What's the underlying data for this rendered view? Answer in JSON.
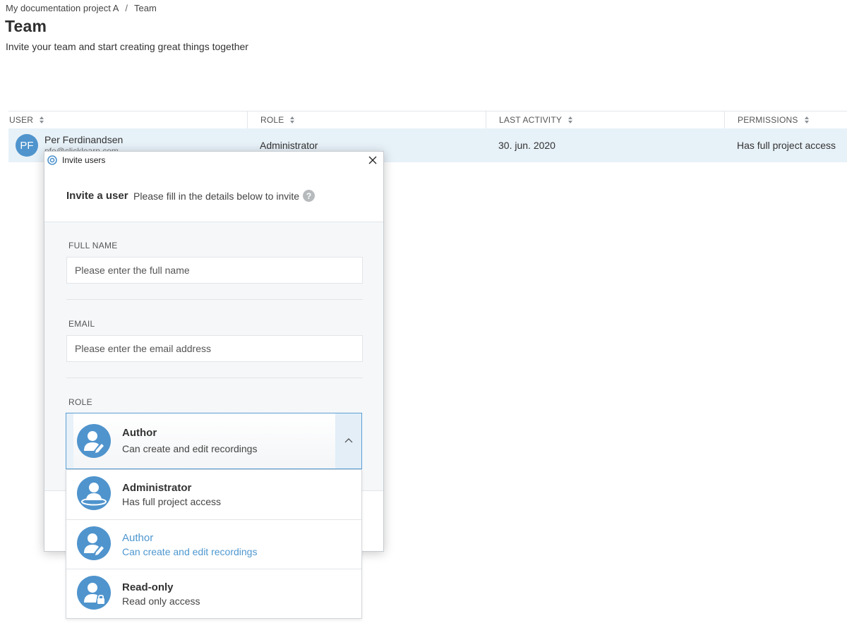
{
  "breadcrumb": {
    "project": "My documentation project A",
    "separator": "/",
    "current": "Team"
  },
  "page": {
    "title": "Team",
    "subtitle": "Invite your team and start creating great things together"
  },
  "table": {
    "columns": {
      "user": "USER",
      "role": "ROLE",
      "last_activity": "LAST ACTIVITY",
      "permissions": "PERMISSIONS"
    },
    "rows": [
      {
        "initials": "PF",
        "name": "Per Ferdinandsen",
        "email": "pfe@clicklearn.com",
        "role": "Administrator",
        "last_activity": "30. jun. 2020",
        "permissions": "Has full project access"
      }
    ]
  },
  "modal": {
    "window_title": "Invite users",
    "heading": "Invite a user",
    "heading_hint": "Please fill in the details below to invite",
    "help_glyph": "?",
    "full_name": {
      "label": "FULL NAME",
      "placeholder": "Please enter the full name",
      "value": ""
    },
    "email": {
      "label": "EMAIL",
      "placeholder": "Please enter the email address",
      "value": ""
    },
    "role": {
      "label": "ROLE",
      "selected": {
        "title": "Author",
        "description": "Can create and edit recordings"
      },
      "options": [
        {
          "title": "Administrator",
          "description": "Has full project access",
          "icon": "admin-user-icon"
        },
        {
          "title": "Author",
          "description": "Can create and edit recordings",
          "icon": "author-user-icon"
        },
        {
          "title": "Read-only",
          "description": "Read only access",
          "icon": "readonly-user-icon"
        }
      ]
    }
  },
  "colors": {
    "accent": "#4f94cd",
    "selected_text": "#4e97cf",
    "row_highlight": "#e7f1f8"
  }
}
